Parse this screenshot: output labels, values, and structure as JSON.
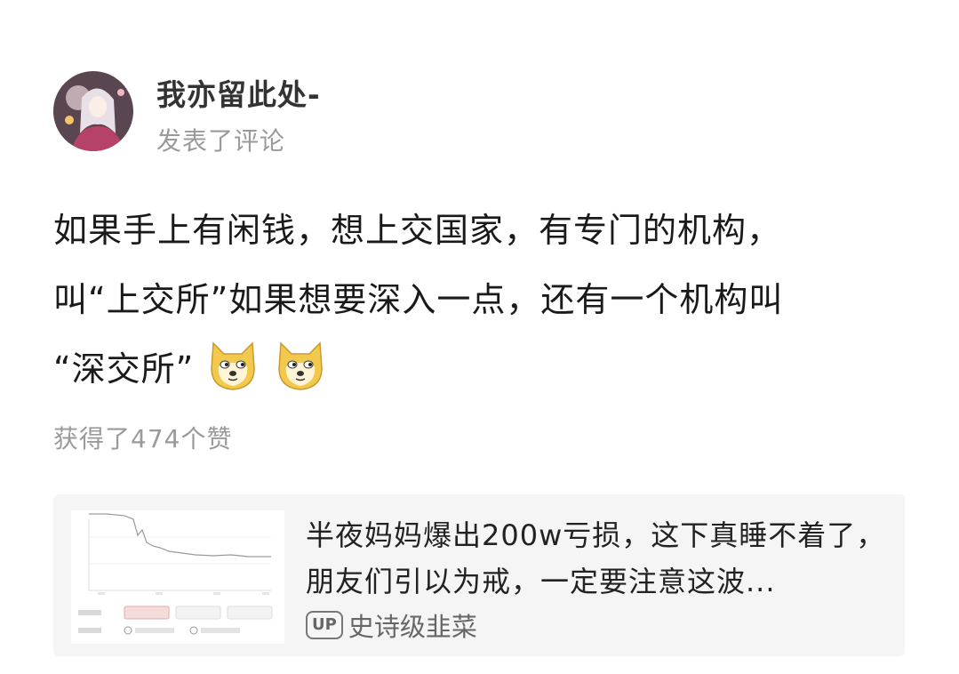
{
  "post": {
    "username": "我亦留此处-",
    "action": "发表了评论",
    "content_lines": [
      "如果手上有闲钱，想上交国家，有专门的机构，",
      "叫“上交所”如果想要深入一点，还有一个机构叫",
      "“深交所”"
    ],
    "emojis": [
      "doge-emoji",
      "doge-emoji"
    ],
    "likes": "获得了474个赞"
  },
  "card": {
    "title": "半夜妈妈爆出200w亏损，这下真睡不着了，朋友们引以为戒，一定要注意这波...",
    "up_badge": "UP",
    "author": "史诗级韭菜"
  }
}
